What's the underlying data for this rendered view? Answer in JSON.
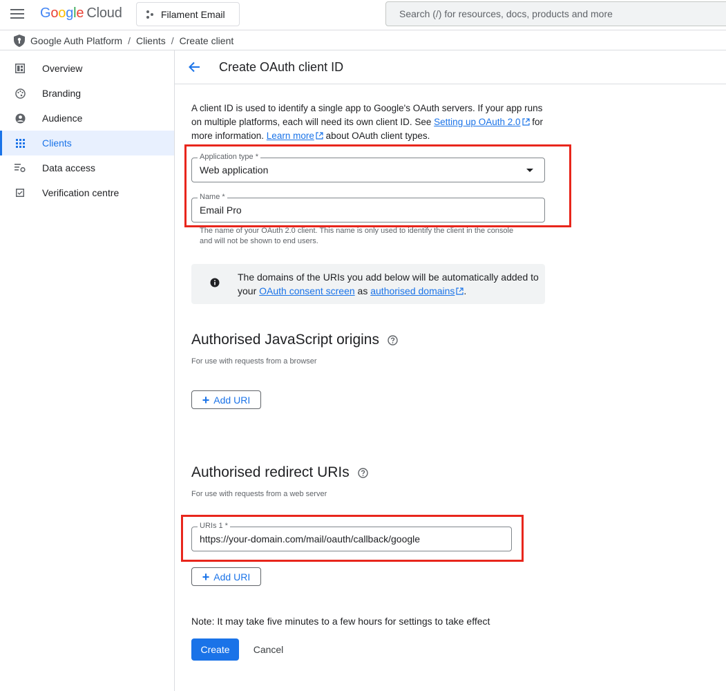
{
  "topbar": {
    "logo_google": "Google",
    "logo_cloud": "Cloud",
    "project_name": "Filament Email",
    "search_placeholder": "Search (/) for resources, docs, products and more"
  },
  "breadcrumb": [
    "Google Auth Platform",
    "Clients",
    "Create client"
  ],
  "sidebar": {
    "items": [
      {
        "label": "Overview",
        "icon": "dashboard-icon",
        "active": false
      },
      {
        "label": "Branding",
        "icon": "palette-icon",
        "active": false
      },
      {
        "label": "Audience",
        "icon": "account-circle-icon",
        "active": false
      },
      {
        "label": "Clients",
        "icon": "grid-icon",
        "active": true
      },
      {
        "label": "Data access",
        "icon": "data-settings-icon",
        "active": false
      },
      {
        "label": "Verification centre",
        "icon": "checkbox-icon",
        "active": false
      }
    ]
  },
  "page": {
    "title": "Create OAuth client ID",
    "intro_part1": "A client ID is used to identify a single app to Google's OAuth servers. If your app runs on multiple platforms, each will need its own client ID. See ",
    "intro_link1": "Setting up OAuth 2.0",
    "intro_part2": " for more information. ",
    "intro_link2": "Learn more",
    "intro_part3": " about OAuth client types."
  },
  "form": {
    "app_type_label": "Application type *",
    "app_type_value": "Web application",
    "name_label": "Name *",
    "name_value": "Email Pro",
    "name_hint": "The name of your OAuth 2.0 client. This name is only used to identify the client in the console and will not be shown to end users."
  },
  "info": {
    "text_part1": "The domains of the URIs you add below will be automatically added to your ",
    "link1": "OAuth consent screen",
    "text_part2": " as ",
    "link2": "authorised domains",
    "text_part3": "."
  },
  "js_origins": {
    "title": "Authorised JavaScript origins",
    "subtitle": "For use with requests from a browser",
    "add_label": "Add URI"
  },
  "redirect_uris": {
    "title": "Authorised redirect URIs",
    "subtitle": "For use with requests from a web server",
    "uri_label": "URIs 1 *",
    "uri_value": "https://your-domain.com/mail/oauth/callback/google",
    "add_label": "Add URI"
  },
  "footer": {
    "note": "Note: It may take five minutes to a few hours for settings to take effect",
    "create_label": "Create",
    "cancel_label": "Cancel"
  },
  "colors": {
    "accent": "#1a73e8",
    "highlight": "#e8261c"
  }
}
